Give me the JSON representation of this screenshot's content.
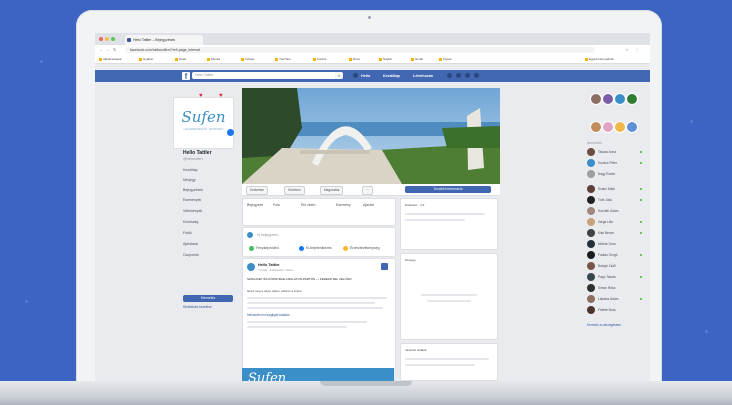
{
  "browser": {
    "tab_title": "Hello Tattler – Bejegyzések",
    "url": "facebook.com/hellosutfen/?ref=page_internal",
    "bookmarks": [
      "Alkalmazások",
      "Gyakori",
      "Hírek",
      "Munka",
      "Térkép",
      "YouTube",
      "Fordító",
      "Drive",
      "Naptár",
      "Gmail",
      "Képek",
      "Egyéb könyvjelzők"
    ],
    "traffic_colors": [
      "#ed6a5e",
      "#f5bf4f",
      "#61c554"
    ]
  },
  "fb_header": {
    "logo": "f",
    "search_placeholder": "Hello Tattler",
    "nav": [
      "Hello",
      "Kezdőlap",
      "Létrehozás"
    ],
    "brand_color": "#4267b2"
  },
  "page": {
    "avatar_text": "Sufen",
    "avatar_sub": "LAKÁSDEKORÁCIÓ · FESTÉSZET",
    "name": "Hello Tattler",
    "handle": "@hellosufen",
    "left_nav": [
      "Kezdőlap",
      "Névjegy",
      "Bejegyzések",
      "Események",
      "Vélemények",
      "Közösség",
      "Fotók",
      "Ajánlások",
      "Csoportok"
    ],
    "promote_label": "Kiemelés",
    "manage_label": "Hirdetések kezelése"
  },
  "actions": {
    "like": "Kedvelem",
    "follow": "Követem",
    "share": "Megosztás",
    "more": "···",
    "signup": "További információ"
  },
  "composer": {
    "tabs": [
      "Bejegyzés",
      "Fotó",
      "Élő videó",
      "Esemény",
      "Ajánlat"
    ],
    "placeholder": "Írj bejegyzést...",
    "chips": [
      "Fénykép/videó",
      "Ki-bejelentkezés",
      "Érzés/tevékenység"
    ]
  },
  "post": {
    "author": "Hello Tattler",
    "time": "7 órája · Közzétette: Sufen",
    "line1": "SZIGLIGET ÉS KÖRNYÉKE A BALATON-PARTON — FEDEZD FEL VELÜNK!",
    "line2": "Nézd meg a teljes cikket, kattints a linkre!",
    "link": "hellosufen.hu/szigliget-balaton",
    "img_text": "Sufen"
  },
  "right_panel": {
    "reviews_label": "Értékelés · 4,9",
    "about_label": "Névjegy",
    "suggest_label": "Javasolt oldalak",
    "contacts_header": "Ismerősök",
    "contacts": [
      "Takács Anna",
      "Kovács Péter",
      "Nagy Eszter",
      "Szabó Márk",
      "Tóth Júlia",
      "Horváth Ádám",
      "Varga Lilla",
      "Kiss Bence",
      "Molnár Dóra",
      "Farkas Gergő",
      "Balogh Zsófi",
      "Papp Tamás",
      "Simon Réka",
      "Lakatos Ádám",
      "Fekete Nóra"
    ],
    "footer": "Keresés a csevegésben"
  }
}
